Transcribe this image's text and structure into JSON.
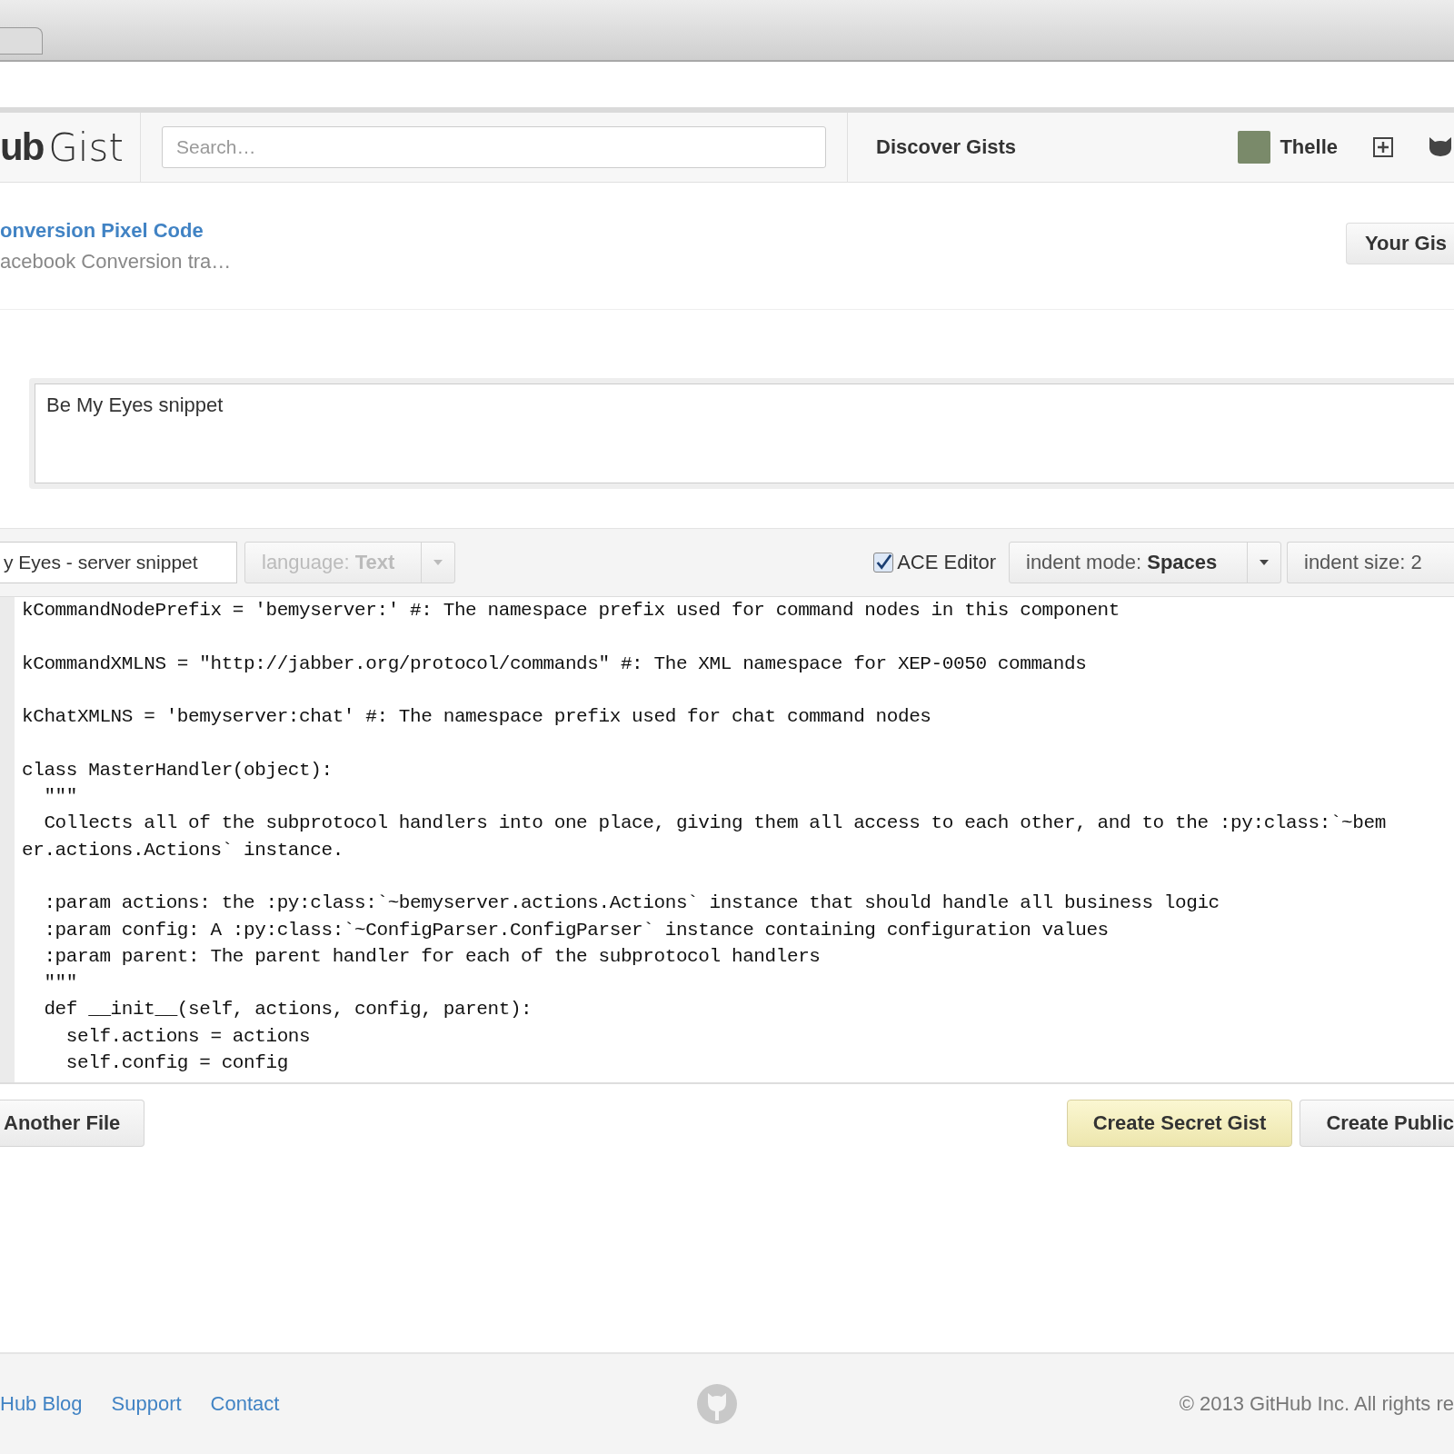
{
  "header": {
    "logo_prefix": "ub",
    "logo_product": "Gist",
    "search": {
      "placeholder": "Search…"
    },
    "nav_link": "Discover Gists",
    "user": "Thelle"
  },
  "gist": {
    "title": "onversion Pixel Code",
    "description": "acebook Conversion tra…",
    "your_gists_button": "Your Gis"
  },
  "description_field": {
    "value": "Be My Eyes snippet"
  },
  "file": {
    "filename": "y Eyes - server snippet",
    "language": {
      "label": "language:",
      "value": "Text",
      "disabled": true
    },
    "ace_editor": {
      "label": "ACE Editor",
      "checked": true
    },
    "indent_mode": {
      "label": "indent mode:",
      "value": "Spaces"
    },
    "indent_size": {
      "label": "indent size: 2"
    }
  },
  "code": {
    "blocks": [
      {
        "lines": [
          "kCommandNodePrefix = 'bemyserver:' #: The namespace prefix used for command nodes in this component"
        ]
      },
      {
        "lines": [
          "kCommandXMLNS = \"http://jabber.org/protocol/commands\" #: The XML namespace for XEP-0050 commands"
        ]
      },
      {
        "lines": [
          "kChatXMLNS = 'bemyserver:chat' #: The namespace prefix used for chat command nodes"
        ]
      },
      {
        "lines": [
          "class MasterHandler(object):",
          "  \"\"\"",
          "  Collects all of the subprotocol handlers into one place, giving them all access to each other, and to the :py:class:`~bem",
          "er.actions.Actions` instance."
        ]
      },
      {
        "lines": [
          "  :param actions: the :py:class:`~bemyserver.actions.Actions` instance that should handle all business logic",
          "  :param config: A :py:class:`~ConfigParser.ConfigParser` instance containing configuration values",
          "  :param parent: The parent handler for each of the subprotocol handlers",
          "  \"\"\"",
          "  def __init__(self, actions, config, parent):",
          "    self.actions = actions",
          "    self.config = config"
        ]
      }
    ]
  },
  "actions": {
    "add_file": "Another File",
    "create_secret": "Create Secret Gist",
    "create_public": "Create Public"
  },
  "footer": {
    "links": [
      "Hub Blog",
      "Support",
      "Contact"
    ],
    "copyright": "© 2013 GitHub Inc. All rights re"
  }
}
